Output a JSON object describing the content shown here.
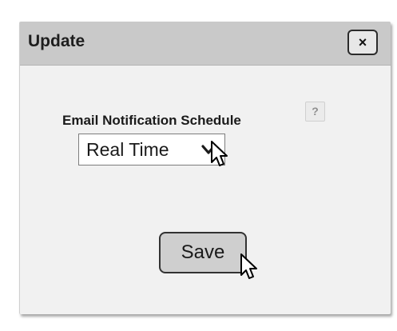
{
  "dialog": {
    "title": "Update",
    "close_label": "×"
  },
  "form": {
    "schedule_label": "Email Notification Schedule",
    "help_label": "?",
    "schedule_selected": "Real Time",
    "save_label": "Save"
  }
}
